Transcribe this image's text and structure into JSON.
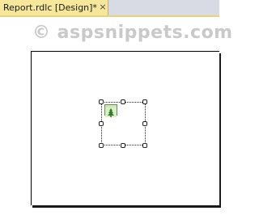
{
  "tab": {
    "title": "Report.rdlc [Design]*",
    "close_glyph": "×"
  },
  "watermark": {
    "text": "© aspsnippets.com"
  },
  "design_surface": {
    "report_item": {
      "type": "image",
      "icon": "image-placeholder-icon"
    }
  },
  "colors": {
    "active_tab": "#f6e79a",
    "tab_strip": "#d8dbe3",
    "watermark": "#c9c9c9"
  }
}
